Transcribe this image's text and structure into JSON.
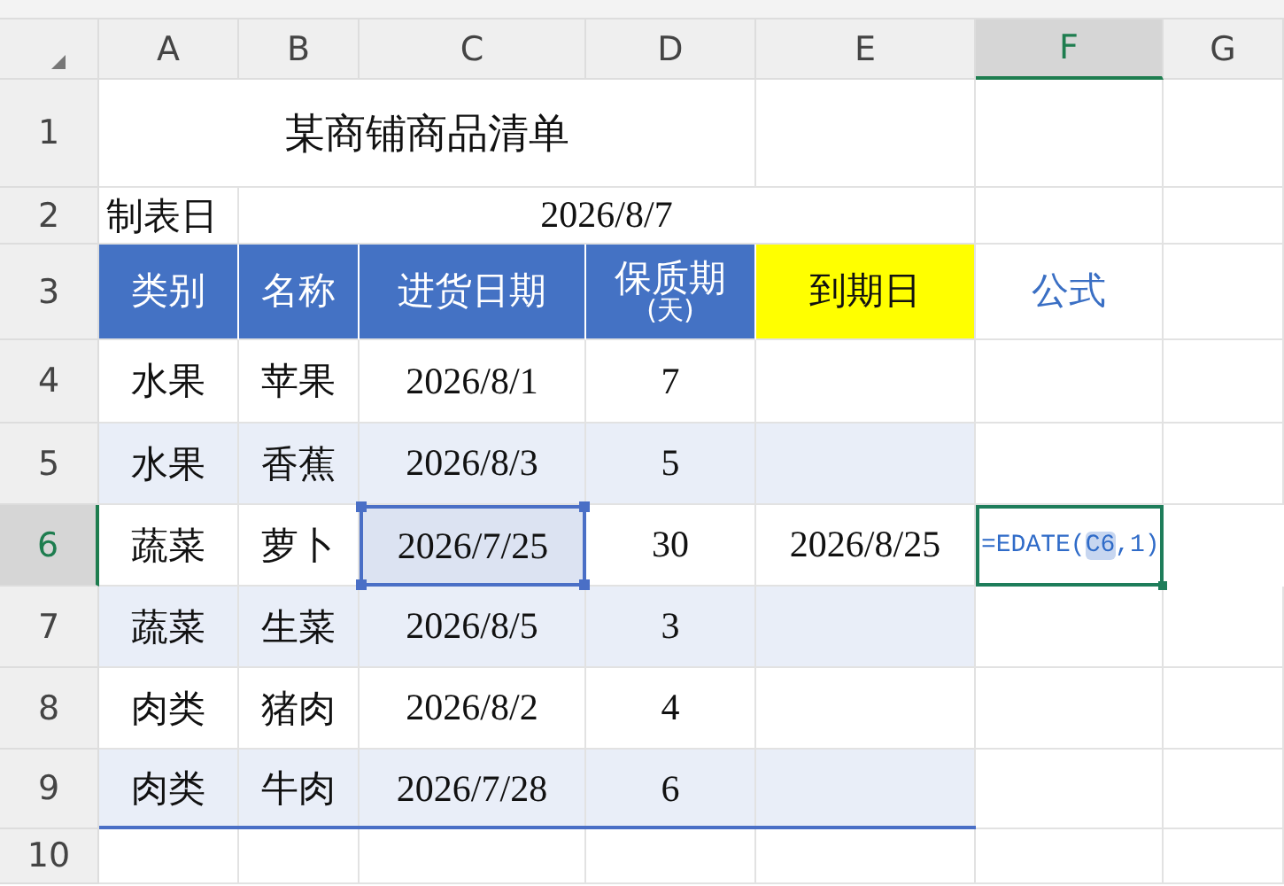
{
  "columns": [
    {
      "label": "A",
      "selected": false
    },
    {
      "label": "B",
      "selected": false
    },
    {
      "label": "C",
      "selected": false
    },
    {
      "label": "D",
      "selected": false
    },
    {
      "label": "E",
      "selected": false
    },
    {
      "label": "F",
      "selected": true
    },
    {
      "label": "G",
      "selected": false
    }
  ],
  "rows": [
    {
      "label": "1",
      "selected": false
    },
    {
      "label": "2",
      "selected": false
    },
    {
      "label": "3",
      "selected": false
    },
    {
      "label": "4",
      "selected": false
    },
    {
      "label": "5",
      "selected": false
    },
    {
      "label": "6",
      "selected": true
    },
    {
      "label": "7",
      "selected": false
    },
    {
      "label": "8",
      "selected": false
    },
    {
      "label": "9",
      "selected": false
    },
    {
      "label": "10",
      "selected": false
    }
  ],
  "title": "某商铺商品清单",
  "date_row": {
    "label": "制表日",
    "value": "2026/8/7"
  },
  "header": [
    {
      "kind": "blue",
      "lines": [
        "类别"
      ]
    },
    {
      "kind": "blue",
      "lines": [
        "名称"
      ]
    },
    {
      "kind": "blue",
      "lines": [
        "进货日期"
      ]
    },
    {
      "kind": "blue",
      "lines": [
        "保质期",
        "(天)"
      ]
    },
    {
      "kind": "yellow",
      "lines": [
        "到期日"
      ]
    },
    {
      "kind": "plain",
      "lines": [
        "公式"
      ]
    }
  ],
  "records": [
    {
      "category": "水果",
      "name": "苹果",
      "purchase_date": "2026/8/1",
      "shelf_life": "7",
      "selected": false
    },
    {
      "category": "水果",
      "name": "香蕉",
      "purchase_date": "2026/8/3",
      "shelf_life": "5",
      "selected": false
    },
    {
      "category": "蔬菜",
      "name": "萝卜",
      "purchase_date": "2026/7/25",
      "shelf_life": "30",
      "selected": true,
      "expiry": "2026/8/25",
      "formula": {
        "prefix": "=EDATE(",
        "ref": "C6",
        "suffix": ",1)"
      }
    },
    {
      "category": "蔬菜",
      "name": "生菜",
      "purchase_date": "2026/8/5",
      "shelf_life": "3",
      "selected": false
    },
    {
      "category": "肉类",
      "name": "猪肉",
      "purchase_date": "2026/8/2",
      "shelf_life": "4",
      "selected": false
    },
    {
      "category": "肉类",
      "name": "牛肉",
      "purchase_date": "2026/7/28",
      "shelf_life": "6",
      "selected": false
    }
  ]
}
